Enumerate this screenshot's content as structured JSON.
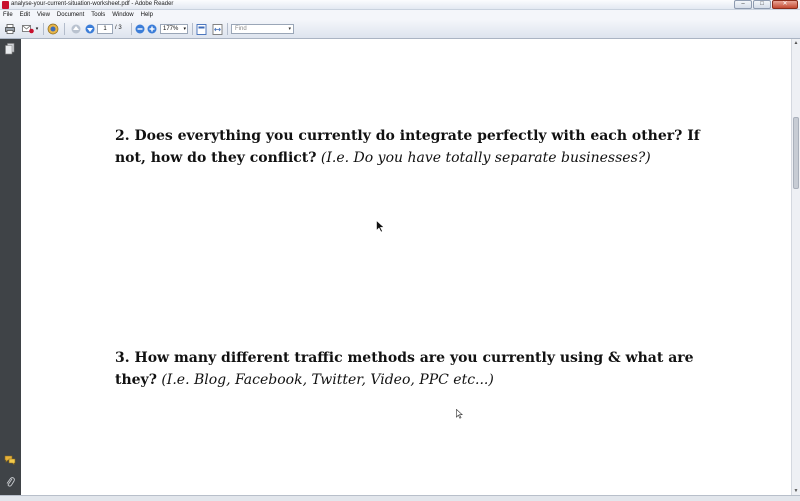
{
  "window": {
    "title": "analyse-your-current-situation-worksheet.pdf - Adobe Reader",
    "min_glyph": "–",
    "max_glyph": "□",
    "close_glyph": "✕"
  },
  "menu": [
    "File",
    "Edit",
    "View",
    "Document",
    "Tools",
    "Window",
    "Help"
  ],
  "toolbar": {
    "page_current": "1",
    "page_total": "/ 3",
    "zoom": "177%",
    "find_placeholder": "Find",
    "icons": [
      "print-icon",
      "email-icon",
      "collaborate-icon",
      "previous-page-icon",
      "next-page-icon",
      "zoom-out-icon",
      "zoom-in-icon",
      "fit-page-icon",
      "fit-width-icon"
    ]
  },
  "leftnav": {
    "icons": [
      "pages-icon",
      "comments-icon",
      "attachments-icon"
    ]
  },
  "document": {
    "q2_bold": "2. Does everything you currently do integrate perfectly with each other? If not, how do they conflict?",
    "q2_italic": "(I.e. Do you have totally separate businesses?)",
    "q3_bold": "3. How many different traffic methods are you currently using & what are they?",
    "q3_italic": "(I.e. Blog, Facebook, Twitter, Video, PPC etc...)"
  },
  "colors": {
    "nav_panel": "#3f4347",
    "titlebar": "#e3e9f2",
    "close_button": "#c44a32"
  }
}
